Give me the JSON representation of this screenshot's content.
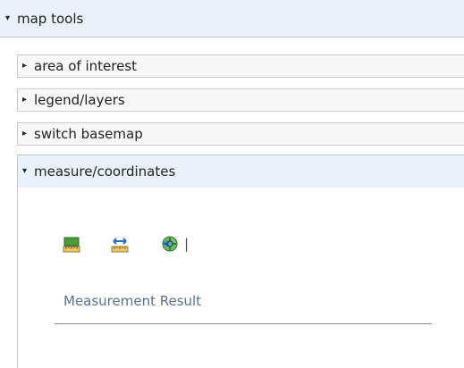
{
  "header": {
    "title": "map tools",
    "arrow": "▾"
  },
  "accordion": {
    "items": [
      {
        "label": "area of interest",
        "arrow": "▸",
        "expanded": false
      },
      {
        "label": "legend/layers",
        "arrow": "▸",
        "expanded": false
      },
      {
        "label": "switch basemap",
        "arrow": "▸",
        "expanded": false
      },
      {
        "label": "measure/coordinates",
        "arrow": "▾",
        "expanded": true
      }
    ]
  },
  "measure": {
    "tools": [
      {
        "name": "area-measure-icon"
      },
      {
        "name": "distance-measure-icon"
      },
      {
        "name": "location-coordinates-icon"
      }
    ],
    "separator": "|",
    "result_label": "Measurement Result"
  },
  "colors": {
    "header_bg": "#eaf1f9",
    "item_bg": "#f7f7f7",
    "result_text": "#5a7390"
  }
}
